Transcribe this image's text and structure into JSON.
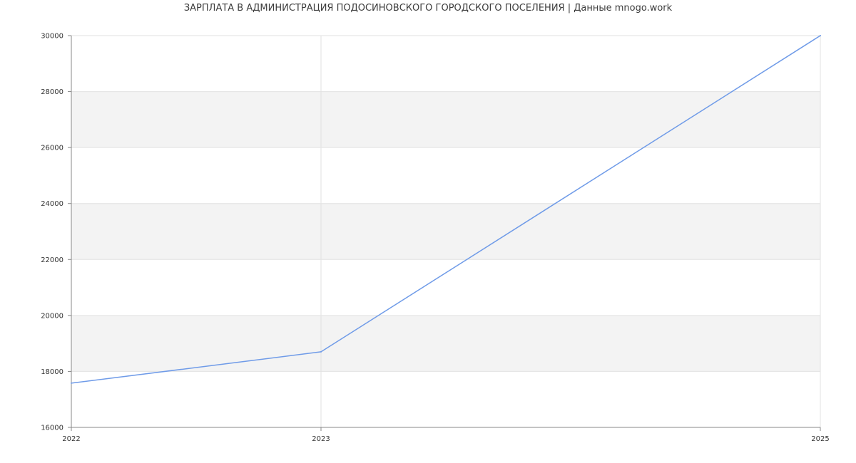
{
  "chart_data": {
    "type": "line",
    "title": "ЗАРПЛАТА В АДМИНИСТРАЦИЯ ПОДОСИНОВСКОГО ГОРОДСКОГО ПОСЕЛЕНИЯ | Данные mnogo.work",
    "xlabel": "",
    "ylabel": "",
    "x": [
      "2022",
      "2023",
      "2025"
    ],
    "series": [
      {
        "values": [
          17580,
          18700,
          30000
        ]
      }
    ],
    "ylim": [
      16000,
      30000
    ],
    "yticks": [
      "16000",
      "18000",
      "20000",
      "22000",
      "24000",
      "26000",
      "28000",
      "30000"
    ],
    "xticks": [
      "2022",
      "2023",
      "2025"
    ],
    "grid": true,
    "banded_background": true,
    "colors": {
      "line": "#6f9be8",
      "band": "#f3f3f3",
      "grid": "#e2e2e2",
      "axis": "#888888"
    }
  }
}
